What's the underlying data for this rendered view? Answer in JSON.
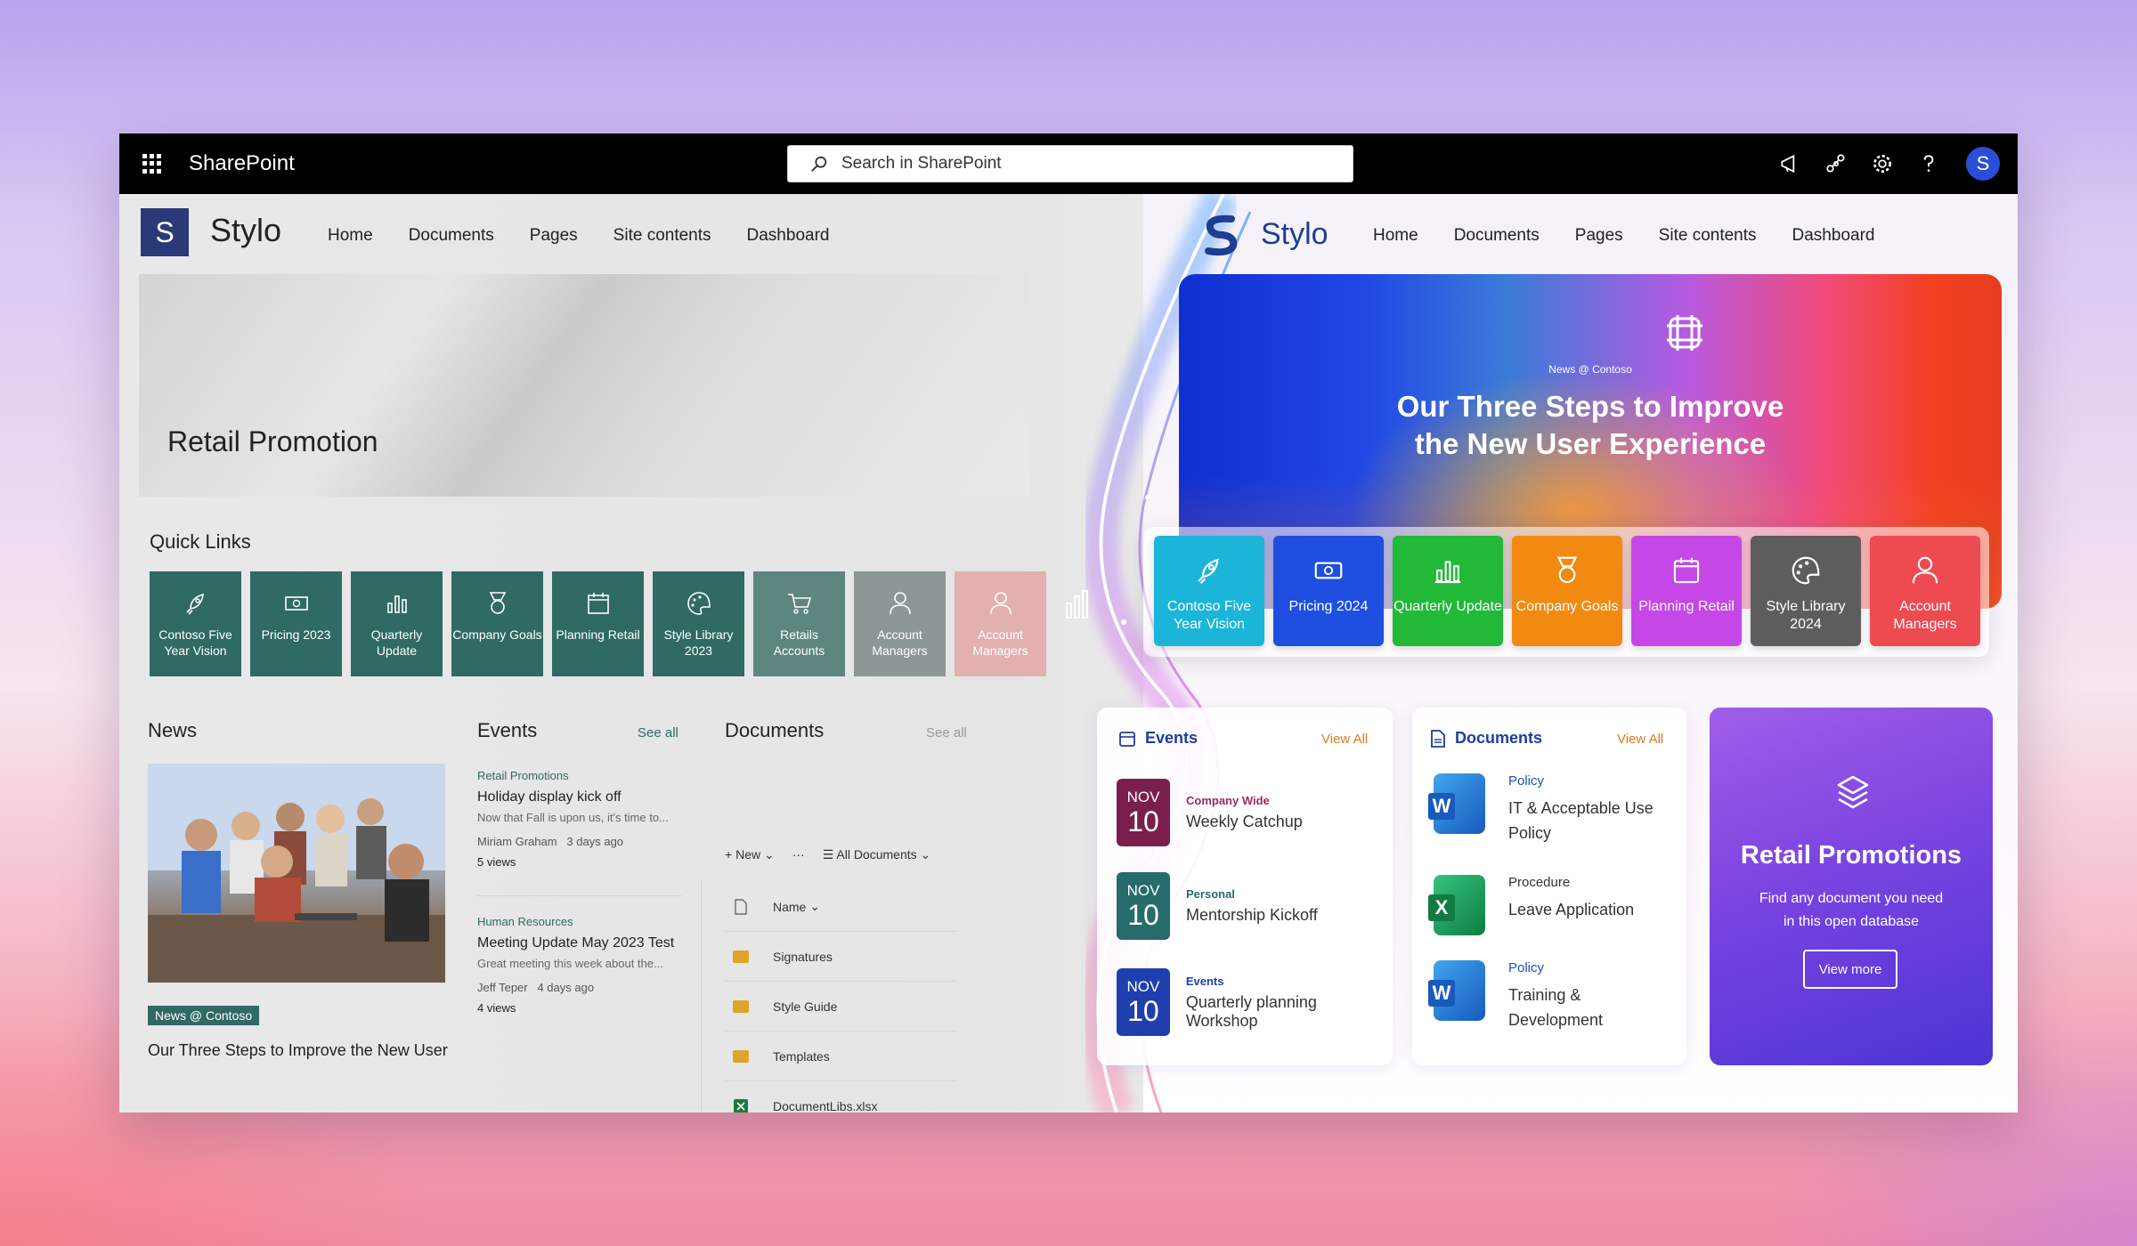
{
  "suite": {
    "brand": "SharePoint",
    "search_placeholder": "Search in SharePoint",
    "avatar_initial": "S"
  },
  "left": {
    "logo_letter": "S",
    "site_name": "Stylo",
    "nav": [
      "Home",
      "Documents",
      "Pages",
      "Site contents",
      "Dashboard"
    ],
    "hero_title": "Retail Promotion",
    "quick_links_title": "Quick Links",
    "quick_links": [
      {
        "label": "Contoso Five Year Vision",
        "icon": "rocket-icon"
      },
      {
        "label": "Pricing 2023",
        "icon": "money-icon"
      },
      {
        "label": "Quarterly Update",
        "icon": "bar-chart-icon"
      },
      {
        "label": "Company Goals",
        "icon": "medal-icon"
      },
      {
        "label": "Planning Retail",
        "icon": "calendar-icon"
      },
      {
        "label": "Style Library 2023",
        "icon": "palette-icon"
      },
      {
        "label": "Retails Accounts",
        "icon": "cart-icon"
      },
      {
        "label": "Account Managers",
        "icon": "person-icon"
      },
      {
        "label": "Account Managers",
        "icon": "person-icon"
      }
    ],
    "news_title": "News",
    "news_badge": "News @ Contoso",
    "news_headline": "Our Three Steps to Improve the  New User",
    "events_title": "Events",
    "events_see_all": "See all",
    "events": [
      {
        "category": "Retail Promotions",
        "title": "Holiday display kick off",
        "excerpt": "Now that Fall is upon us, it's time to...",
        "author": "Miriam Graham",
        "when": "3 days ago",
        "views": "5 views"
      },
      {
        "category": "Human Resources",
        "title": "Meeting Update May 2023 Test",
        "excerpt": "Great meeting this week about the...",
        "author": "Jeff Teper",
        "when": "4 days ago",
        "views": "4 views"
      }
    ],
    "documents_title": "Documents",
    "documents_see_all": "See all",
    "doc_tools": {
      "new": "New",
      "more": "···",
      "view": "All Documents"
    },
    "doc_header": "Name",
    "doc_rows": [
      "Signatures",
      "Style Guide",
      "Templates",
      "DocumentLibs.xlsx"
    ]
  },
  "right": {
    "site_name": "Stylo",
    "nav": [
      "Home",
      "Documents",
      "Pages",
      "Site contents",
      "Dashboard"
    ],
    "hero_kicker": "News @ Contoso",
    "hero_title_l1": "Our Three Steps to Improve",
    "hero_title_l2": "the New User Experience",
    "tiles": [
      {
        "label": "Contoso Five Year Vision",
        "color": "#1bb5d9",
        "icon": "rocket-icon"
      },
      {
        "label": "Pricing 2024",
        "color": "#1f4fe0",
        "icon": "money-icon"
      },
      {
        "label": "Quarterly Update",
        "color": "#22b838",
        "icon": "bar-chart-icon"
      },
      {
        "label": "Company Goals",
        "color": "#f28a12",
        "icon": "medal-icon"
      },
      {
        "label": "Planning Retail",
        "color": "#c548e6",
        "icon": "calendar-icon"
      },
      {
        "label": "Style Library 2024",
        "color": "#5d5d5d",
        "icon": "palette-icon"
      },
      {
        "label": "Account Managers",
        "color": "#ee4a52",
        "icon": "person-icon"
      }
    ],
    "events_title": "Events",
    "events_view_all": "View All",
    "events": [
      {
        "month": "NOV",
        "day": "10",
        "category": "Company Wide",
        "title": "Weekly Catchup",
        "color": "#7a1f4c",
        "cat_color": "#9b2a62"
      },
      {
        "month": "NOV",
        "day": "10",
        "category": "Personal",
        "title": "Mentorship Kickoff",
        "color": "#276b6b",
        "cat_color": "#276b6b"
      },
      {
        "month": "NOV",
        "day": "10",
        "category": "Events",
        "title": "Quarterly planning Workshop",
        "color": "#1f3fae",
        "cat_color": "#1f3fae"
      }
    ],
    "documents_title": "Documents",
    "documents_view_all": "View All",
    "documents": [
      {
        "category": "Policy",
        "title_l1": "IT & Acceptable Use",
        "title_l2": "Policy",
        "app": "W",
        "cat_color": "#1f4fc4"
      },
      {
        "category": "Procedure",
        "title_l1": "Leave Application",
        "title_l2": "",
        "app": "X",
        "cat_color": "#333333"
      },
      {
        "category": "Policy",
        "title_l1": "Training &",
        "title_l2": "Development",
        "app": "W",
        "cat_color": "#1f4fc4"
      }
    ],
    "promo": {
      "title": "Retail Promotions",
      "desc": "Find any document you need in this open database",
      "button": "View more"
    }
  }
}
